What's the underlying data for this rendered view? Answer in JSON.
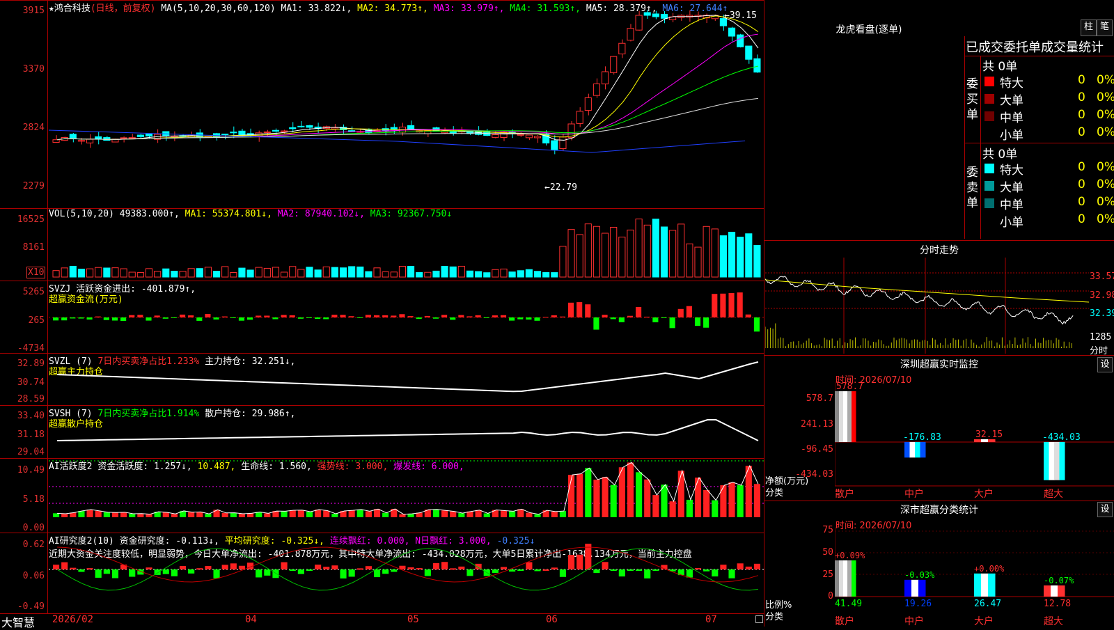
{
  "stock": {
    "name": "鸿合科技",
    "mode": "(日线，前复权)",
    "star": "★"
  },
  "main_header": {
    "ma_params": "MA(5,10,20,30,60,120)",
    "ma1": "MA1: 33.822↓,",
    "ma2": "MA2: 34.773↑,",
    "ma3": "MA3: 33.979↑,",
    "ma4": "MA4: 31.593↑,",
    "ma5": "MA5: 28.379↑,",
    "ma6": "MA6: 27.644↑"
  },
  "main_axis": [
    "3915",
    "3370",
    "2824",
    "2279"
  ],
  "main_annotations": {
    "high": "39.15",
    "low": "22.79"
  },
  "vol": {
    "header": "VOL(5,10,20)",
    "value": "49383.000↑,",
    "ma1": "MA1: 55374.801↓,",
    "ma2": "MA2: 87940.102↓,",
    "ma3": "MA3: 92367.750↓",
    "axis": [
      "16525",
      "8161"
    ],
    "unit": "X10"
  },
  "svzj": {
    "header": "SVZJ  活跃资金进出: -401.879↑,",
    "sub": "超赢资金流(万元)",
    "axis": [
      "5265",
      "265",
      "-4734"
    ]
  },
  "svzl": {
    "header1": "SVZL (7)",
    "header2": "7日内买卖净占比1.233%",
    "header3": "主力持仓: 32.251↓,",
    "sub": "超赢主力持仓",
    "axis": [
      "32.89",
      "30.74",
      "28.59"
    ]
  },
  "svsh": {
    "header1": "SVSH (7)",
    "header2": "7日内买卖净占比1.914%",
    "header3": "散户持仓: 29.986↑,",
    "sub": "超赢散户持仓",
    "axis": [
      "33.40",
      "31.18",
      "29.04"
    ]
  },
  "ai_act": {
    "h1": "AI活跃度2",
    "h2": "资金活跃度: 1.257↓,",
    "h3": "10.487,",
    "h4": "生命线: 1.560,",
    "h5": "强势线: 3.000,",
    "h6": "爆发线: 6.000,",
    "axis": [
      "10.49",
      "5.18",
      "0.00"
    ]
  },
  "ai_res": {
    "h1": "AI研究度2(10)",
    "h2": "资金研究度: -0.113↓,",
    "h3": "平均研究度: -0.325↓,",
    "h4": "连续飘红: 0.000,",
    "h5": "N日飘红: 3.000,",
    "h6": "-0.325↓",
    "desc": "近期大资金关注度较低，明显弱势，今日大单净流出: -401.878万元，其中特大单净流出: -434.028万元，大单5日累计净出-1638.134万元，当前主力控盘",
    "axis": [
      "0.62",
      "0.06",
      "-0.49"
    ]
  },
  "xaxis": {
    "brand": "大智慧",
    "dates": [
      "2026/02",
      "04",
      "05",
      "06",
      "07"
    ]
  },
  "lhb": {
    "title": "龙虎看盘(逐单)",
    "btn1": "柱",
    "btn2": "笔",
    "tabs": "已成交委托单成交量统计",
    "buy_label": "委买单",
    "sell_label": "委卖单",
    "buy_total": "共 0单",
    "sell_total": "共 0单",
    "buy_rows": [
      {
        "name": "特大",
        "n": "0",
        "p": "0%",
        "color": "#ff0000"
      },
      {
        "name": "大单",
        "n": "0",
        "p": "0%",
        "color": "#a00000"
      },
      {
        "name": "中单",
        "n": "0",
        "p": "0%",
        "color": "#700000"
      },
      {
        "name": "小单",
        "n": "0",
        "p": "0%",
        "color": ""
      }
    ],
    "sell_rows": [
      {
        "name": "特大",
        "n": "0",
        "p": "0%",
        "color": "#00ffff"
      },
      {
        "name": "大单",
        "n": "0",
        "p": "0%",
        "color": "#009a9a"
      },
      {
        "name": "中单",
        "n": "0",
        "p": "0%",
        "color": "#006f70"
      },
      {
        "name": "小单",
        "n": "0",
        "p": "0%",
        "color": ""
      }
    ]
  },
  "fenshi": {
    "title": "分时走势",
    "axis": [
      "33.57",
      "32.98",
      "32.39"
    ],
    "vol": "1285",
    "vol_unit": "分时"
  },
  "monitor": {
    "title": "深圳超赢实时监控",
    "btn": "设",
    "time": "时间: 2026/07/10",
    "axis": [
      "578.7",
      "241.13",
      "-96.45",
      "-434.03"
    ],
    "ylabel": "净额(万元)",
    "xlabel": "分类",
    "bars": [
      {
        "cat": "散户",
        "v": "578.7",
        "val": 578.7
      },
      {
        "cat": "中户",
        "v": "-176.83",
        "val": -176.83
      },
      {
        "cat": "大户",
        "v": "32.15",
        "val": 32.15
      },
      {
        "cat": "超大",
        "v": "-434.03",
        "val": -434.03
      }
    ]
  },
  "classify": {
    "title": "深市超赢分类统计",
    "btn": "设",
    "time": "时间: 2026/07/10",
    "axis": [
      "75",
      "50",
      "25",
      "0"
    ],
    "ylabel": "比例%",
    "xlabel": "分类",
    "bars": [
      {
        "cat": "散户",
        "chg": "+0.09%",
        "v": "41.49",
        "val": 41.49
      },
      {
        "cat": "中户",
        "chg": "-0.03%",
        "v": "19.26",
        "val": 19.26
      },
      {
        "cat": "大户",
        "chg": "+0.00%",
        "v": "26.47",
        "val": 26.47
      },
      {
        "cat": "超大",
        "chg": "-0.07%",
        "v": "12.78",
        "val": 12.78
      }
    ]
  },
  "chart_data": [
    {
      "type": "candlestick",
      "title": "鸿合科技 (日线，前复权)",
      "ylim": [
        22.79,
        39.15
      ],
      "annotations": {
        "high": 39.15,
        "low": 22.79
      },
      "series": [
        {
          "name": "MA1",
          "last": 33.822
        },
        {
          "name": "MA2",
          "last": 34.773
        },
        {
          "name": "MA3",
          "last": 33.979
        },
        {
          "name": "MA4",
          "last": 31.593
        },
        {
          "name": "MA5",
          "last": 28.379
        },
        {
          "name": "MA6",
          "last": 27.644
        }
      ]
    },
    {
      "type": "bar",
      "title": "VOL(5,10,20)",
      "last": 49383.0,
      "ma": [
        55374.801,
        87940.102,
        92367.75
      ]
    },
    {
      "type": "bar",
      "title": "SVZJ 活跃资金进出",
      "last": -401.879,
      "ylim": [
        -4734,
        5265
      ]
    },
    {
      "type": "line",
      "title": "SVZL 主力持仓",
      "last": 32.251,
      "ylim": [
        28.59,
        32.89
      ]
    },
    {
      "type": "line",
      "title": "SVSH 散户持仓",
      "last": 29.986,
      "ylim": [
        29.04,
        33.4
      ]
    },
    {
      "type": "bar",
      "title": "AI活跃度2",
      "last": 1.257,
      "ylim": [
        0,
        10.49
      ]
    },
    {
      "type": "bar",
      "title": "AI研究度2(10)",
      "last": -0.113,
      "ylim": [
        -0.49,
        0.62
      ]
    },
    {
      "type": "bar",
      "title": "深圳超赢实时监控",
      "categories": [
        "散户",
        "中户",
        "大户",
        "超大"
      ],
      "values": [
        578.7,
        -176.83,
        32.15,
        -434.03
      ],
      "ylabel": "净额(万元)"
    },
    {
      "type": "bar",
      "title": "深市超赢分类统计",
      "categories": [
        "散户",
        "中户",
        "大户",
        "超大"
      ],
      "values": [
        41.49,
        19.26,
        26.47,
        12.78
      ],
      "changes": [
        "+0.09%",
        "-0.03%",
        "+0.00%",
        "-0.07%"
      ],
      "ylabel": "比例%"
    }
  ]
}
